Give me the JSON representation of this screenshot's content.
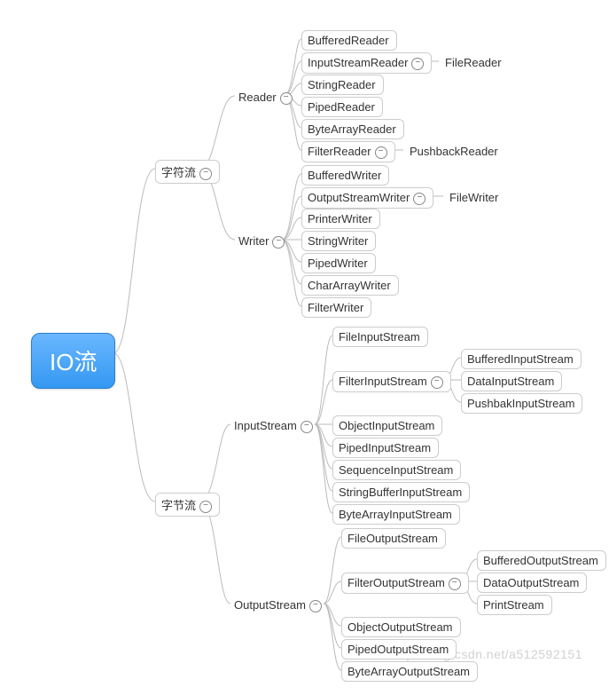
{
  "root": "IO流",
  "watermark": "http://blog.csdn.net/a512592151",
  "category": {
    "char_stream": "字符流",
    "byte_stream": "字节流"
  },
  "char_stream": {
    "reader": {
      "label": "Reader",
      "children": {
        "buffered": "BufferedReader",
        "inputstream": "InputStreamReader",
        "inputstream_child": "FileReader",
        "string": "StringReader",
        "piped": "PipedReader",
        "bytearray": "ByteArrayReader",
        "filter": "FilterReader",
        "filter_child": "PushbackReader"
      }
    },
    "writer": {
      "label": "Writer",
      "children": {
        "buffered": "BufferedWriter",
        "outputstream": "OutputStreamWriter",
        "outputstream_child": "FileWriter",
        "printer": "PrinterWriter",
        "string": "StringWriter",
        "piped": "PipedWriter",
        "chararray": "CharArrayWriter",
        "filter": "FilterWriter"
      }
    }
  },
  "byte_stream": {
    "input": {
      "label": "InputStream",
      "children": {
        "file": "FileInputStream",
        "filter": "FilterInputStream",
        "filter_children": {
          "buffered": "BufferedInputStream",
          "data": "DataInputStream",
          "pushbak": "PushbakInputStream"
        },
        "object": "ObjectInputStream",
        "piped": "PipedInputStream",
        "sequence": "SequenceInputStream",
        "stringbuffer": "StringBufferInputStream",
        "bytearray": "ByteArrayInputStream"
      }
    },
    "output": {
      "label": "OutputStream",
      "children": {
        "file": "FileOutputStream",
        "filter": "FilterOutputStream",
        "filter_children": {
          "buffered": "BufferedOutputStream",
          "data": "DataOutputStream",
          "print": "PrintStream"
        },
        "object": "ObjectOutputStream",
        "piped": "PipedOutputStream",
        "bytearray": "ByteArrayOutputStream"
      }
    }
  }
}
